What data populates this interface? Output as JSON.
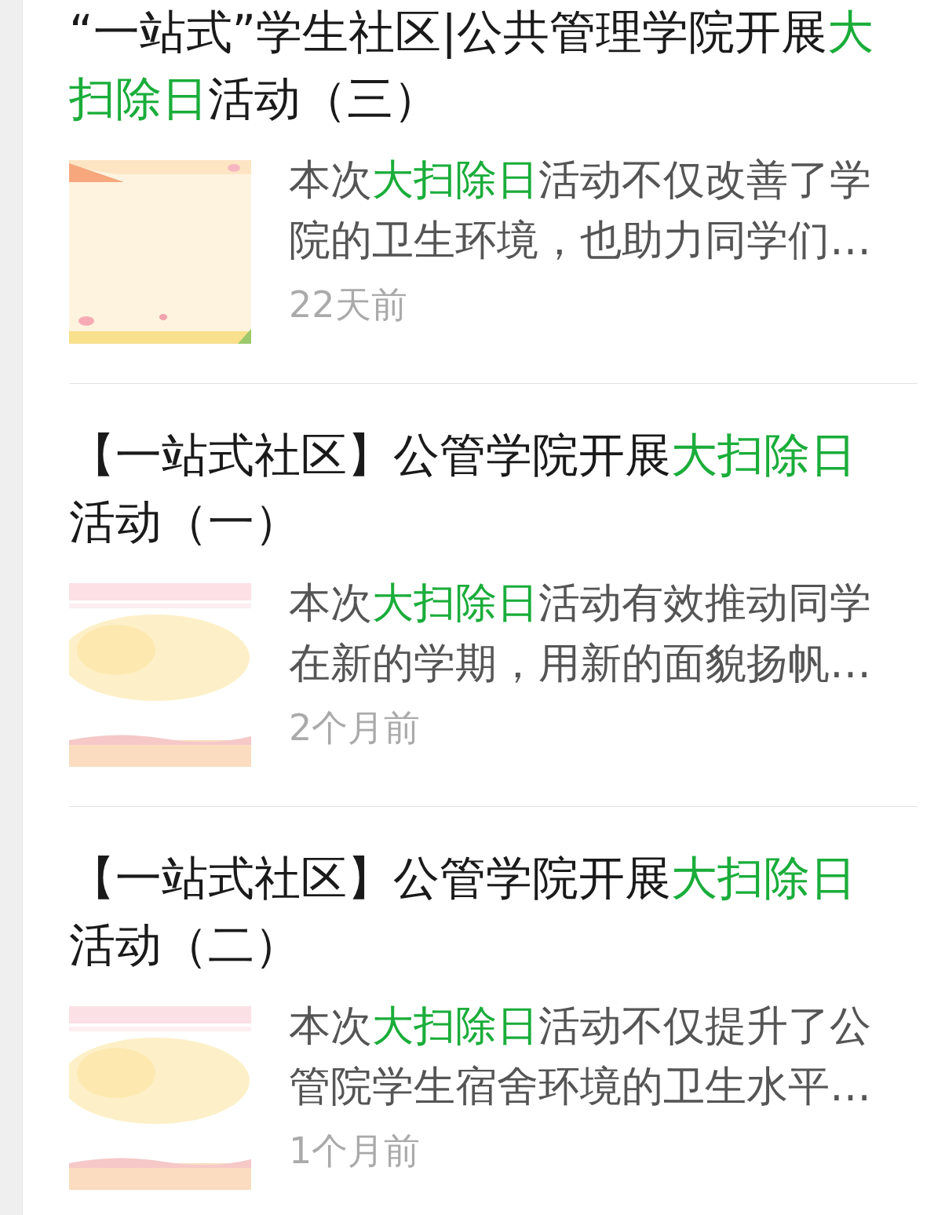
{
  "results": [
    {
      "title": [
        {
          "text": "“一站式”学生社区|公共管理学院开展",
          "highlight": false
        },
        {
          "text": "大扫除日",
          "highlight": true
        },
        {
          "text": "活动（三）",
          "highlight": false
        }
      ],
      "summary": [
        {
          "text": "本次",
          "highlight": false
        },
        {
          "text": "大扫除日",
          "highlight": true
        },
        {
          "text": "活动不仅改善了学院的卫生环境，也助力同学们…",
          "highlight": false
        }
      ],
      "time": "22天前"
    },
    {
      "title": [
        {
          "text": "【一站式社区】公管学院开展",
          "highlight": false
        },
        {
          "text": "大扫除日",
          "highlight": true
        },
        {
          "text": "活动（一）",
          "highlight": false
        }
      ],
      "summary": [
        {
          "text": "本次",
          "highlight": false
        },
        {
          "text": "大扫除日",
          "highlight": true
        },
        {
          "text": "活动有效推动同学在新的学期，用新的面貌扬帆…",
          "highlight": false
        }
      ],
      "time": "2个月前"
    },
    {
      "title": [
        {
          "text": "【一站式社区】公管学院开展",
          "highlight": false
        },
        {
          "text": "大扫除日",
          "highlight": true
        },
        {
          "text": "活动（二）",
          "highlight": false
        }
      ],
      "summary": [
        {
          "text": "本次",
          "highlight": false
        },
        {
          "text": "大扫除日",
          "highlight": true
        },
        {
          "text": "活动不仅提升了公管院学生宿舍环境的卫生水平…",
          "highlight": false
        }
      ],
      "time": "1个月前"
    }
  ]
}
